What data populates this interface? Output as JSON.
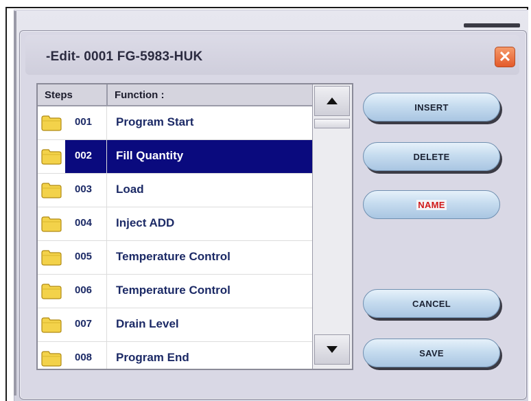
{
  "dialog": {
    "title": "-Edit- 0001 FG-5983-HUK",
    "close_glyph": "✕"
  },
  "list": {
    "headers": {
      "steps": "Steps",
      "function": "Function :"
    },
    "rows": [
      {
        "step": "001",
        "function": "Program Start",
        "selected": false
      },
      {
        "step": "002",
        "function": "Fill Quantity",
        "selected": true
      },
      {
        "step": "003",
        "function": "Load",
        "selected": false
      },
      {
        "step": "004",
        "function": "Inject ADD",
        "selected": false
      },
      {
        "step": "005",
        "function": "Temperature Control",
        "selected": false
      },
      {
        "step": "006",
        "function": "Temperature Control",
        "selected": false
      },
      {
        "step": "007",
        "function": "Drain Level",
        "selected": false
      },
      {
        "step": "008",
        "function": "Program End",
        "selected": false
      }
    ],
    "row_icon": "folder-icon"
  },
  "buttons": {
    "insert": "INSERT",
    "delete": "DELETE",
    "name": "NAME",
    "cancel": "CANCEL",
    "save": "SAVE"
  },
  "colors": {
    "selection": "#0a0a7e",
    "row_text": "#1c2a66",
    "name_label": "#d01818",
    "close_button": "#e45a2a"
  }
}
